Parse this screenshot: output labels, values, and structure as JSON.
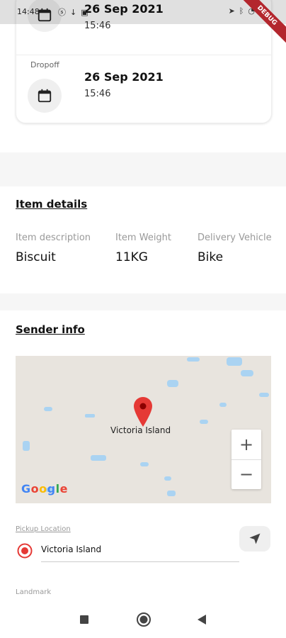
{
  "status_bar": {
    "time": "14:48",
    "left_icons": [
      "s-icon",
      "download-icon",
      "briefcase-icon"
    ],
    "right_icons": [
      "location-icon",
      "bluetooth-icon",
      "wifi-icon"
    ],
    "debug_ribbon": "DEBUG"
  },
  "schedule": {
    "pickup": {
      "date": "26 Sep 2021",
      "time": "15:46"
    },
    "dropoff": {
      "label": "Dropoff",
      "date": "26 Sep 2021",
      "time": "15:46"
    }
  },
  "item_details": {
    "title": "Item details",
    "columns": [
      {
        "label": "Item description",
        "value": "Biscuit"
      },
      {
        "label": "Item Weight",
        "value": "11KG"
      },
      {
        "label": "Delivery Vehicle",
        "value": "Bike"
      }
    ]
  },
  "sender_info": {
    "title": "Sender info",
    "map": {
      "place_label": "Victoria Island",
      "zoom_in": "+",
      "zoom_out": "−",
      "logo_letters": [
        "G",
        "o",
        "o",
        "g",
        "l",
        "e"
      ],
      "logo_colors": [
        "#4285F4",
        "#EA4335",
        "#FBBC05",
        "#4285F4",
        "#34A853",
        "#EA4335"
      ]
    },
    "pickup_location_label": "Pickup Location",
    "pickup_location_value": "Victoria Island",
    "landmark_label": "Landmark"
  },
  "colors": {
    "accent_red": "#e53935",
    "muted_text": "#999999"
  }
}
